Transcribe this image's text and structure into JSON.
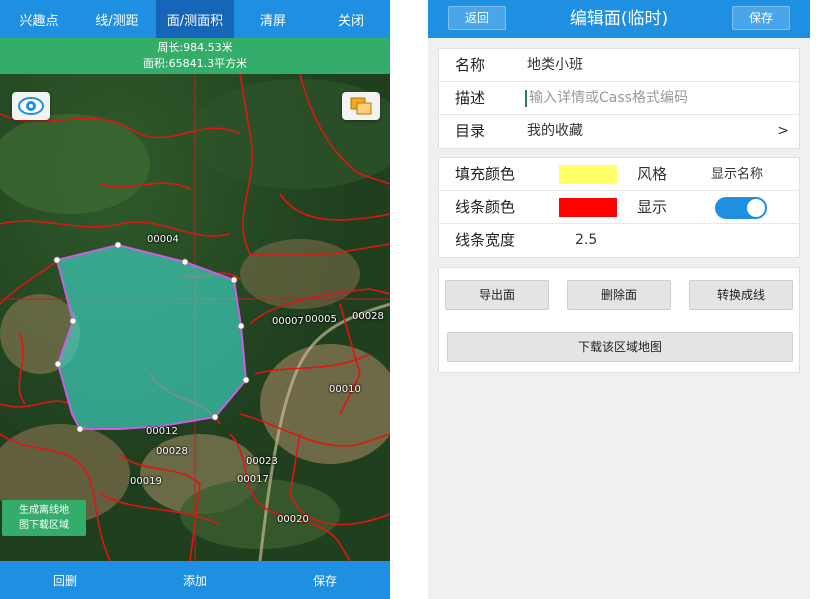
{
  "left": {
    "nav": [
      "兴趣点",
      "线/测距",
      "面/测面积",
      "清屏",
      "关闭"
    ],
    "measure": {
      "perimeter": "周长:984.53米",
      "area": "面积:65841.3平方米"
    },
    "map_labels": [
      "00004",
      "00007",
      "00005",
      "00028",
      "00010",
      "00012",
      "00028",
      "00023",
      "00019",
      "00017",
      "00020"
    ],
    "offline_button": [
      "生成离线地",
      "图下载区域"
    ],
    "bottom": [
      "回删",
      "添加",
      "保存"
    ],
    "icons": {
      "eye": "eye-icon",
      "layers": "layers-icon"
    }
  },
  "right": {
    "header": {
      "back": "返回",
      "title": "编辑面(临时)",
      "save": "保存"
    },
    "info": {
      "name_label": "名称",
      "name_value": "地类小班",
      "desc_label": "描述",
      "desc_placeholder": "输入详情或Cass格式编码",
      "dir_label": "目录",
      "dir_value": "我的收藏",
      "dir_chevron": ">"
    },
    "style": {
      "fill_label": "填充颜色",
      "fill_color": "#ffff66",
      "style_label": "风格",
      "style_value": "显示名称",
      "line_label": "线条颜色",
      "line_color": "#ff0000",
      "show_label": "显示",
      "show_on": true,
      "width_label": "线条宽度",
      "width_value": "2.5"
    },
    "actions": {
      "export": "导出面",
      "delete": "删除面",
      "convert": "转换成线",
      "download": "下载该区域地图"
    }
  }
}
